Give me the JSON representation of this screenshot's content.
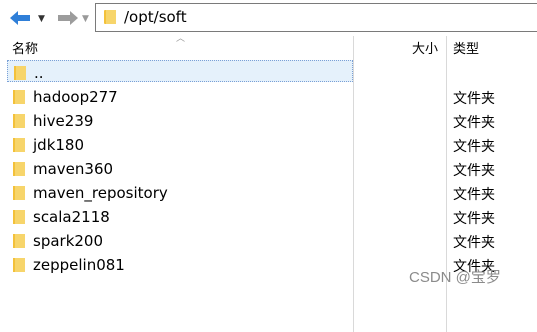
{
  "toolbar": {
    "path": "/opt/soft"
  },
  "columns": {
    "name": "名称",
    "size": "大小",
    "type": "类型"
  },
  "rows": [
    {
      "name": "..",
      "type": ""
    },
    {
      "name": "hadoop277",
      "type": "文件夹"
    },
    {
      "name": "hive239",
      "type": "文件夹"
    },
    {
      "name": "jdk180",
      "type": "文件夹"
    },
    {
      "name": "maven360",
      "type": "文件夹"
    },
    {
      "name": "maven_repository",
      "type": "文件夹"
    },
    {
      "name": "scala2118",
      "type": "文件夹"
    },
    {
      "name": "spark200",
      "type": "文件夹"
    },
    {
      "name": "zeppelin081",
      "type": "文件夹"
    }
  ],
  "watermark": "CSDN @宝罗",
  "colors": {
    "folder": "#f3c13a",
    "back_arrow": "#2f7fd8",
    "selection": "#e5f1fb"
  },
  "icons": [
    "back-arrow-icon",
    "forward-arrow-icon",
    "folder-icon",
    "sort-up-icon"
  ]
}
